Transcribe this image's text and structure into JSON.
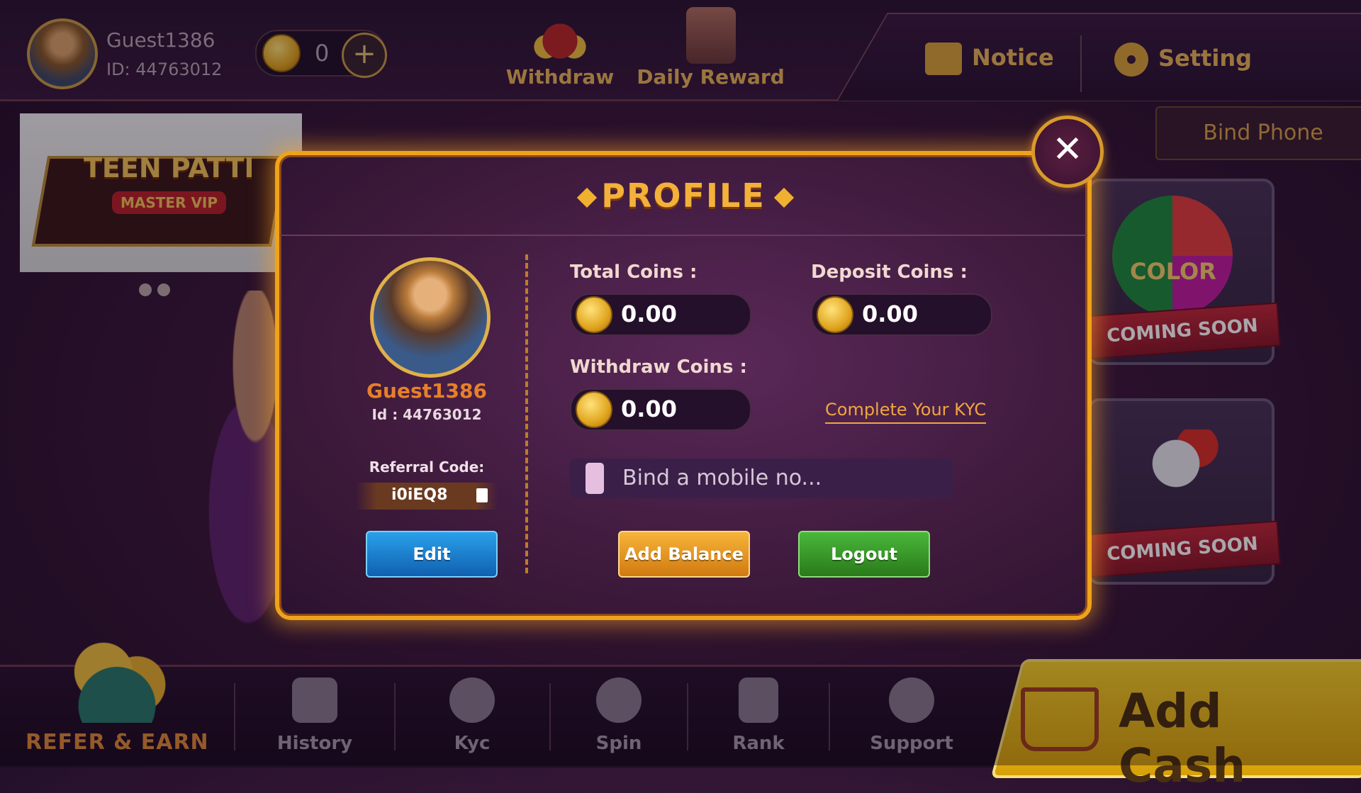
{
  "header": {
    "user_name": "Guest1386",
    "user_id": "ID: 44763012",
    "coin_balance": "0",
    "plus_label": "+",
    "withdraw_label": "Withdraw",
    "daily_reward_label": "Daily Reward",
    "notice_label": "Notice",
    "setting_label": "Setting"
  },
  "bind_phone_label": "Bind Phone",
  "banner": {
    "title": "TEEN PATTI",
    "subtitle": "MASTER VIP"
  },
  "side_cards": [
    {
      "name": "COLOR",
      "ribbon": "COMING SOON"
    },
    {
      "name": "",
      "ribbon": "COMING SOON"
    }
  ],
  "bottom_nav": {
    "refer_label": "REFER & EARN",
    "items": [
      {
        "label": "History",
        "icon": "history-icon"
      },
      {
        "label": "Kyc",
        "icon": "kyc-icon"
      },
      {
        "label": "Spin",
        "icon": "spin-icon"
      },
      {
        "label": "Rank",
        "icon": "rank-icon"
      },
      {
        "label": "Support",
        "icon": "support-icon"
      }
    ],
    "add_cash_label": "Add Cash"
  },
  "profile": {
    "title": "PROFILE",
    "close_label": "✕",
    "name": "Guest1386",
    "id": "Id : 44763012",
    "referral_label": "Referral Code:",
    "referral_code": "i0iEQ8",
    "total_coins_label": "Total Coins :",
    "total_coins": "0.00",
    "deposit_coins_label": "Deposit Coins :",
    "deposit_coins": "0.00",
    "withdraw_coins_label": "Withdraw Coins :",
    "withdraw_coins": "0.00",
    "kyc_link": "Complete Your KYC",
    "mobile_placeholder": "Bind a mobile no...",
    "edit_label": "Edit",
    "add_balance_label": "Add Balance",
    "logout_label": "Logout"
  },
  "colors": {
    "accent_gold": "#f0a21a",
    "edit_blue": "#1a80d0",
    "add_orange": "#e4961f",
    "logout_green": "#3a9a2a"
  }
}
